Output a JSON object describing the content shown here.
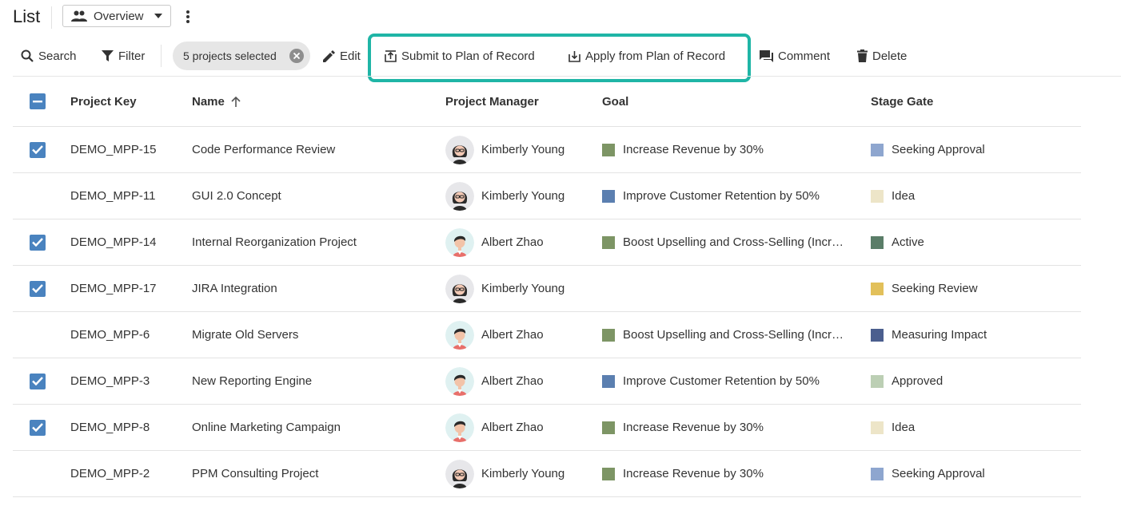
{
  "header": {
    "title": "List",
    "view_label": "Overview"
  },
  "toolbar": {
    "search": "Search",
    "filter": "Filter",
    "selection_chip": "5 projects selected",
    "edit": "Edit",
    "submit": "Submit to Plan of Record",
    "apply": "Apply from Plan of Record",
    "comment": "Comment",
    "delete": "Delete"
  },
  "colors": {
    "accent": "#1fb5a6",
    "checkbox": "#4a83bf"
  },
  "table": {
    "columns": {
      "key": "Project Key",
      "name": "Name",
      "manager": "Project Manager",
      "goal": "Goal",
      "stage": "Stage Gate"
    },
    "rows": [
      {
        "selected": true,
        "key": "DEMO_MPP-15",
        "name": "Code Performance Review",
        "manager": "Kimberly Young",
        "avatar": "female",
        "goal": "Increase Revenue by 30%",
        "goal_color": "#7d9565",
        "stage": "Seeking Approval",
        "stage_color": "#8ea6cf"
      },
      {
        "selected": false,
        "key": "DEMO_MPP-11",
        "name": "GUI 2.0 Concept",
        "manager": "Kimberly Young",
        "avatar": "female",
        "goal": "Improve Customer Retention by 50%",
        "goal_color": "#5b7fb0",
        "stage": "Idea",
        "stage_color": "#ede5c8"
      },
      {
        "selected": true,
        "key": "DEMO_MPP-14",
        "name": "Internal Reorganization Project",
        "manager": "Albert Zhao",
        "avatar": "male",
        "goal": "Boost Upselling and Cross-Selling (Increase)",
        "goal_color": "#7d9565",
        "stage": "Active",
        "stage_color": "#5a7d68"
      },
      {
        "selected": true,
        "key": "DEMO_MPP-17",
        "name": "JIRA Integration",
        "manager": "Kimberly Young",
        "avatar": "female",
        "goal": "",
        "goal_color": "",
        "stage": "Seeking Review",
        "stage_color": "#e2c05a"
      },
      {
        "selected": false,
        "key": "DEMO_MPP-6",
        "name": "Migrate Old Servers",
        "manager": "Albert Zhao",
        "avatar": "male",
        "goal": "Boost Upselling and Cross-Selling (Increase)",
        "goal_color": "#7d9565",
        "stage": "Measuring Impact",
        "stage_color": "#4b5e8e"
      },
      {
        "selected": true,
        "key": "DEMO_MPP-3",
        "name": "New Reporting Engine",
        "manager": "Albert Zhao",
        "avatar": "male",
        "goal": "Improve Customer Retention by 50%",
        "goal_color": "#5b7fb0",
        "stage": "Approved",
        "stage_color": "#bccfb4"
      },
      {
        "selected": true,
        "key": "DEMO_MPP-8",
        "name": "Online Marketing Campaign",
        "manager": "Albert Zhao",
        "avatar": "male",
        "goal": "Increase Revenue by 30%",
        "goal_color": "#7d9565",
        "stage": "Idea",
        "stage_color": "#ede5c8"
      },
      {
        "selected": false,
        "key": "DEMO_MPP-2",
        "name": "PPM Consulting Project",
        "manager": "Kimberly Young",
        "avatar": "female",
        "goal": "Increase Revenue by 30%",
        "goal_color": "#7d9565",
        "stage": "Seeking Approval",
        "stage_color": "#8ea6cf"
      }
    ]
  }
}
